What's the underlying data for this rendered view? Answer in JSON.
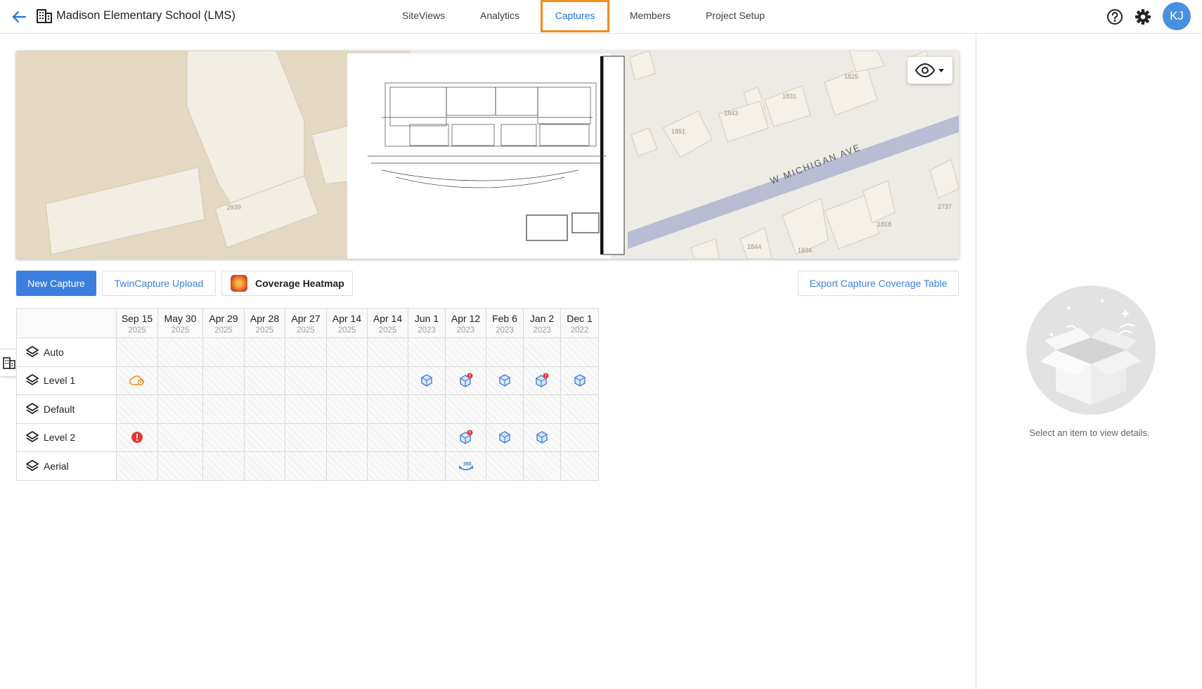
{
  "header": {
    "project_title": "Madison Elementary School (LMS)",
    "tabs": [
      {
        "label": "SiteViews"
      },
      {
        "label": "Analytics"
      },
      {
        "label": "Captures",
        "active": true
      },
      {
        "label": "Members"
      },
      {
        "label": "Project Setup"
      }
    ],
    "user_initials": "KJ",
    "icons": [
      "back-arrow-icon",
      "building-icon",
      "help-icon",
      "gear-icon"
    ]
  },
  "map": {
    "street_label": "W MICHIGAN AVE",
    "parcel_numbers": [
      "2939",
      "1825",
      "1831",
      "1843",
      "1851",
      "1818",
      "1844",
      "1834",
      "2737"
    ],
    "view_toggle_icon": "eye-icon"
  },
  "toolbar": {
    "new_capture": "New Capture",
    "twincapture_upload": "TwinCapture Upload",
    "coverage_heatmap": "Coverage Heatmap",
    "export_table": "Export Capture Coverage Table"
  },
  "table": {
    "columns": [
      {
        "date": "Sep 15",
        "year": "2025"
      },
      {
        "date": "May 30",
        "year": "2025"
      },
      {
        "date": "Apr 29",
        "year": "2025"
      },
      {
        "date": "Apr 28",
        "year": "2025"
      },
      {
        "date": "Apr 27",
        "year": "2025"
      },
      {
        "date": "Apr 14",
        "year": "2025"
      },
      {
        "date": "Apr 14",
        "year": "2025"
      },
      {
        "date": "Jun 1",
        "year": "2023"
      },
      {
        "date": "Apr 12",
        "year": "2023"
      },
      {
        "date": "Feb 6",
        "year": "2023"
      },
      {
        "date": "Jan 2",
        "year": "2023"
      },
      {
        "date": "Dec 1",
        "year": "2022"
      }
    ],
    "rows": [
      {
        "label": "Auto",
        "cells": [
          "",
          "",
          "",
          "",
          "",
          "",
          "",
          "",
          "",
          "",
          "",
          ""
        ]
      },
      {
        "label": "Level 1",
        "cells": [
          "cloud-upload",
          "",
          "",
          "",
          "",
          "",
          "",
          "capture",
          "capture-alert",
          "capture",
          "capture-alert",
          "capture"
        ]
      },
      {
        "label": "Default",
        "cells": [
          "",
          "",
          "",
          "",
          "",
          "",
          "",
          "",
          "",
          "",
          "",
          ""
        ]
      },
      {
        "label": "Level 2",
        "cells": [
          "error",
          "",
          "",
          "",
          "",
          "",
          "",
          "",
          "capture-alert",
          "capture",
          "capture",
          ""
        ]
      },
      {
        "label": "Aerial",
        "cells": [
          "",
          "",
          "",
          "",
          "",
          "",
          "",
          "",
          "pano-360",
          "",
          "",
          ""
        ]
      }
    ]
  },
  "detail_panel": {
    "empty_message": "Select an item to view details."
  },
  "colors": {
    "accent": "#3a7fdf",
    "active_tab_outline": "#f28c1b",
    "warning_orange": "#ef8a1f",
    "error_red": "#e53935"
  }
}
